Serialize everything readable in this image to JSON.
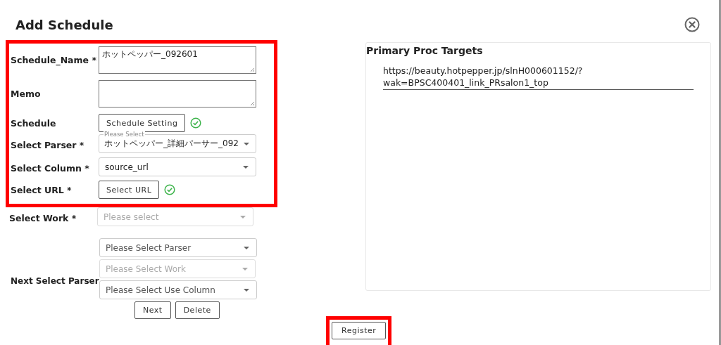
{
  "dialog": {
    "title": "Add Schedule"
  },
  "sections": [
    {
      "highlighted": true,
      "fields": [
        {
          "kind": "textarea",
          "label": "Schedule_Name *",
          "value": "ホットペッパー_092601"
        },
        {
          "kind": "textarea",
          "label": "Memo"
        },
        {
          "kind": "button",
          "label": "Schedule",
          "button": "Schedule Setting",
          "done": true
        },
        {
          "kind": "select",
          "label": "Select Parser *",
          "floating_label": "Please Select",
          "value": "ホットペッパー_詳細パーサー_092",
          "disabled": false
        },
        {
          "kind": "select",
          "label": "Select Column *",
          "value": "source_url",
          "disabled": false
        },
        {
          "kind": "button",
          "label": "Select URL *",
          "button": "Select URL",
          "done": true
        }
      ]
    },
    {
      "highlighted": false,
      "fields": [
        {
          "kind": "select",
          "label": "Select Work *",
          "placeholder": "Please select",
          "disabled": true
        }
      ]
    }
  ],
  "next_parser": {
    "label": "Next Select Parser",
    "selects": [
      {
        "placeholder": "Please Select Parser",
        "disabled": false
      },
      {
        "placeholder": "Please Select Work",
        "disabled": true
      },
      {
        "placeholder": "Please Select Use Column",
        "disabled": false
      }
    ],
    "buttons": [
      "Next",
      "Delete"
    ]
  },
  "targets": {
    "title": "Primary Proc Targets",
    "items": [
      "https://beauty.hotpepper.jp/slnH000601152/?wak=BPSC400401_link_PRsalon1_top"
    ]
  },
  "register": {
    "label": "Register",
    "highlighted": true
  }
}
